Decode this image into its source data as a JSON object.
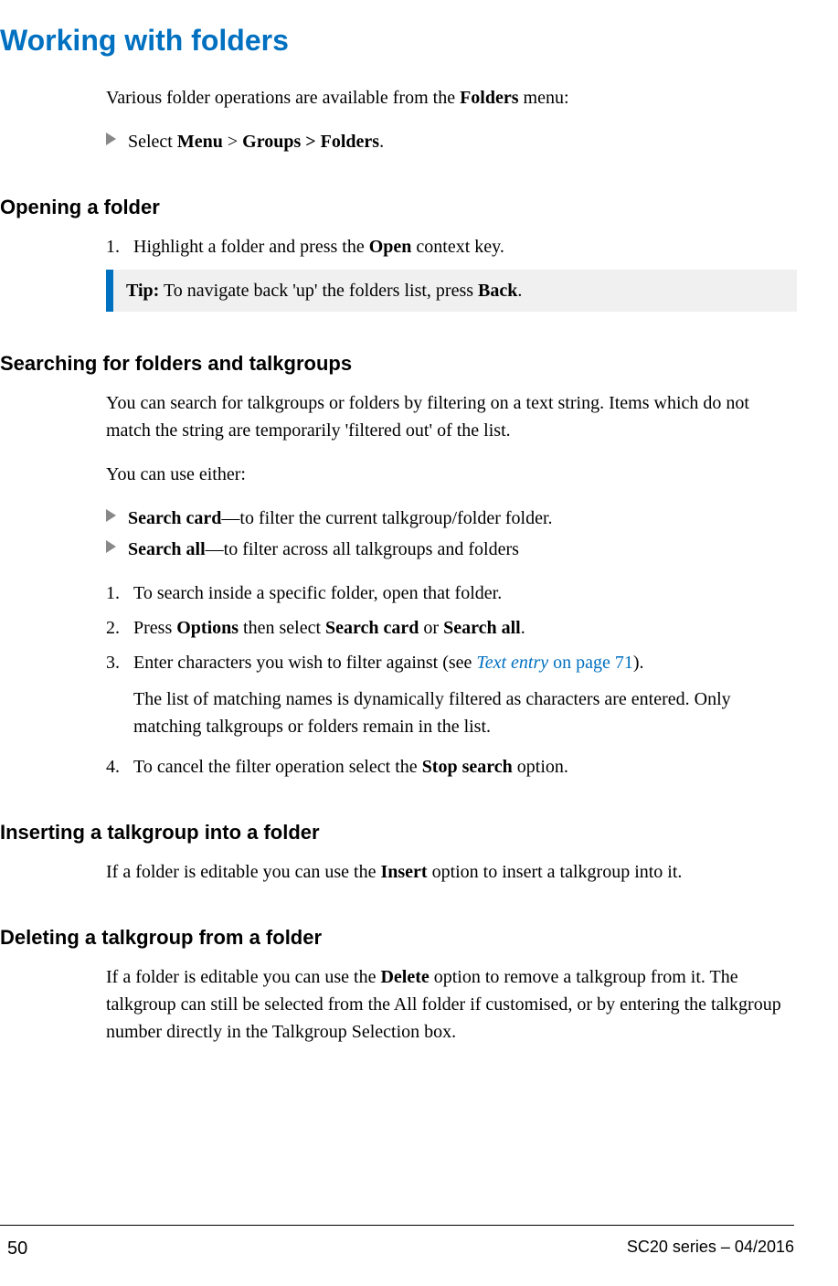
{
  "title": "Working with folders",
  "intro": {
    "pre": "Various folder operations are available from the ",
    "bold1": "Folders",
    "post": " menu:"
  },
  "menu_path": {
    "pre": "Select ",
    "b1": "Menu",
    "sep": " > ",
    "b2": "Groups > Folders",
    "end": "."
  },
  "opening": {
    "heading": "Opening a folder",
    "step1": {
      "pre": "Highlight a folder and press the ",
      "b": "Open",
      "post": " context key."
    },
    "tip": {
      "label": "Tip:",
      "pre": "  To navigate back 'up' the folders list, press ",
      "b": "Back",
      "post": "."
    }
  },
  "searching": {
    "heading": "Searching for folders and talkgroups",
    "p1": "You can search for talkgroups or folders by filtering on a text string. Items which do not match the string are temporarily 'filtered out' of the list.",
    "p2": "You can use either:",
    "bullet1": {
      "b": "Search card",
      "post": "—to filter the current talkgroup/folder folder."
    },
    "bullet2": {
      "b": "Search all",
      "post": "—to filter across all talkgroups and folders"
    },
    "steps": {
      "s1": "To search inside a specific folder, open that folder.",
      "s2": {
        "pre": "Press ",
        "b1": "Options",
        "mid": " then select ",
        "b2": "Search card",
        "or": " or ",
        "b3": "Search all",
        "end": "."
      },
      "s3": {
        "pre": "Enter characters you wish to filter against (see ",
        "link_italic": "Text entry",
        "link_rest": " on page 71",
        "post": ")."
      },
      "s3b": "The list of matching names is dynamically filtered as characters are entered. Only matching talkgroups or folders remain in the list.",
      "s4": {
        "pre": "To cancel the filter operation select the ",
        "b": "Stop search",
        "post": " option."
      }
    }
  },
  "inserting": {
    "heading": "Inserting a talkgroup into a folder",
    "p": {
      "pre": "If a folder is editable you can use the ",
      "b": "Insert",
      "post": " option to insert a talkgroup into it."
    }
  },
  "deleting": {
    "heading": "Deleting a talkgroup from a folder",
    "p": {
      "pre": "If a folder is editable you can use the ",
      "b": "Delete",
      "post": " option to remove a talkgroup from it.  The talkgroup can still be selected from the All folder if customised, or by entering the talkgroup number directly in the Talkgroup Selection box."
    }
  },
  "footer": {
    "page": "50",
    "doc": "SC20 series – 04/2016"
  }
}
